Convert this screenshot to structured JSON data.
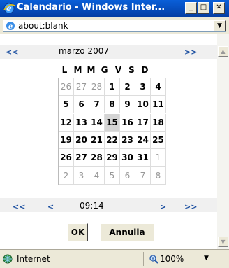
{
  "window": {
    "title": "Calendario - Windows Inter...",
    "minimize_label": "_",
    "maximize_label": "□",
    "close_label": "✕"
  },
  "address": {
    "url": "about:blank",
    "dropdown_glyph": "▼"
  },
  "calendar": {
    "nav_top": {
      "prev_month": "<<",
      "next_month": ">>"
    },
    "month_label": "marzo 2007",
    "day_headers": [
      "L",
      "M",
      "M",
      "G",
      "V",
      "S",
      "D"
    ],
    "weeks": [
      [
        {
          "d": "26",
          "o": true
        },
        {
          "d": "27",
          "o": true
        },
        {
          "d": "28",
          "o": true
        },
        {
          "d": "1"
        },
        {
          "d": "2"
        },
        {
          "d": "3"
        },
        {
          "d": "4"
        }
      ],
      [
        {
          "d": "5"
        },
        {
          "d": "6"
        },
        {
          "d": "7"
        },
        {
          "d": "8"
        },
        {
          "d": "9"
        },
        {
          "d": "10"
        },
        {
          "d": "11"
        }
      ],
      [
        {
          "d": "12"
        },
        {
          "d": "13"
        },
        {
          "d": "14"
        },
        {
          "d": "15",
          "today": true
        },
        {
          "d": "16"
        },
        {
          "d": "17"
        },
        {
          "d": "18"
        }
      ],
      [
        {
          "d": "19"
        },
        {
          "d": "20"
        },
        {
          "d": "21"
        },
        {
          "d": "22"
        },
        {
          "d": "23"
        },
        {
          "d": "24"
        },
        {
          "d": "25"
        }
      ],
      [
        {
          "d": "26"
        },
        {
          "d": "27"
        },
        {
          "d": "28"
        },
        {
          "d": "29"
        },
        {
          "d": "30"
        },
        {
          "d": "31"
        },
        {
          "d": "1",
          "o": true
        }
      ],
      [
        {
          "d": "2",
          "o": true
        },
        {
          "d": "3",
          "o": true
        },
        {
          "d": "4",
          "o": true
        },
        {
          "d": "5",
          "o": true
        },
        {
          "d": "6",
          "o": true
        },
        {
          "d": "7",
          "o": true
        },
        {
          "d": "8",
          "o": true
        }
      ]
    ],
    "nav_bottom": {
      "prev_hour": "<<",
      "prev_min": "<",
      "next_min": ">",
      "next_hour": ">>"
    },
    "time": "09:14",
    "ok_label": "OK",
    "cancel_label": "Annulla"
  },
  "status": {
    "zone": "Internet",
    "zoom": "100%",
    "zoom_dropdown": "▼"
  },
  "colors": {
    "titlebar": "#0751c2",
    "nav_link": "#1a4ea0",
    "today_bg": "#d4d4d4"
  },
  "icons": {
    "app": "ie-logo-icon",
    "address": "ie-page-icon",
    "status": "globe-icon",
    "zoom": "magnifier-icon"
  }
}
